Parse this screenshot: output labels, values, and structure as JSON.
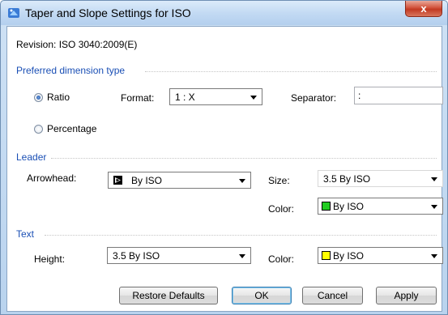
{
  "window": {
    "title": "Taper and Slope Settings for ISO",
    "close_label": "x"
  },
  "revision": {
    "label": "Revision: ISO 3040:2009(E)"
  },
  "preferred": {
    "section_title": "Preferred dimension type",
    "ratio_label": "Ratio",
    "ratio_checked": true,
    "percentage_label": "Percentage",
    "format_label": "Format:",
    "format_value": "1 : X",
    "separator_label": "Separator:",
    "separator_value": ":"
  },
  "leader": {
    "section_title": "Leader",
    "arrowhead_label": "Arrowhead:",
    "arrowhead_value": "By ISO",
    "size_label": "Size:",
    "size_value": "3.5 By ISO",
    "color_label": "Color:",
    "color_value": "By ISO",
    "color_swatch": "#22cc22"
  },
  "text": {
    "section_title": "Text",
    "height_label": "Height:",
    "height_value": "3.5 By ISO",
    "color_label": "Color:",
    "color_value": "By ISO",
    "color_swatch": "#ffff00"
  },
  "buttons": {
    "restore_defaults": "Restore Defaults",
    "ok": "OK",
    "cancel": "Cancel",
    "apply": "Apply"
  },
  "icons": {
    "app": "app-icon",
    "arrowhead": "arrowhead-icon",
    "dropdown": "chevron-down-icon"
  }
}
